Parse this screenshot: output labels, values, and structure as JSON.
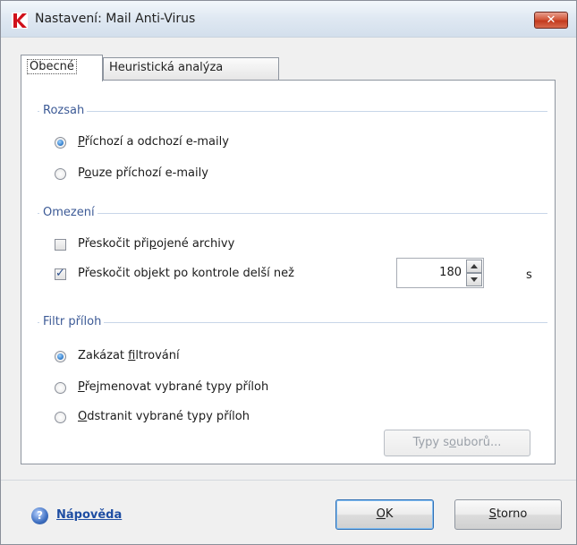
{
  "window": {
    "title": "Nastavení: Mail Anti-Virus",
    "close_glyph": "✕"
  },
  "tabs": [
    {
      "label": "Obecné",
      "active": true
    },
    {
      "label": "Heuristická analýza",
      "active": false
    }
  ],
  "rozsah": {
    "title": "Rozsah",
    "options": [
      {
        "label_pre": "",
        "label_u": "P",
        "label_post": "říchozí a odchozí e-maily",
        "selected": true
      },
      {
        "label_pre": "P",
        "label_u": "o",
        "label_post": "uze příchozí e-maily",
        "selected": false
      }
    ]
  },
  "omezeni": {
    "title": "Omezení",
    "items": [
      {
        "label_pre": "Přeskočit při",
        "label_u": "p",
        "label_post": "ojené archivy",
        "checked": false
      },
      {
        "label": "Přeskočit objekt po kontrole delší než",
        "checked": true
      }
    ],
    "timeout_value": "180",
    "unit": "s"
  },
  "filtr": {
    "title": "Filtr příloh",
    "options": [
      {
        "label_pre": "Zakázat ",
        "label_u": "f",
        "label_post": "iltrování",
        "selected": true
      },
      {
        "label_pre": "",
        "label_u": "P",
        "label_post": "řejmenovat vybrané typy příloh",
        "selected": false
      },
      {
        "label_pre": "",
        "label_u": "O",
        "label_post": "dstranit vybrané typy příloh",
        "selected": false
      }
    ],
    "file_types_pre": "Typy s",
    "file_types_u": "o",
    "file_types_post": "uborů..."
  },
  "footer": {
    "help_label": "Nápověda",
    "help_glyph": "?",
    "ok_u": "O",
    "ok_post": "K",
    "cancel_u": "S",
    "cancel_post": "torno"
  },
  "colors": {
    "group_title": "#3c5a96",
    "link": "#1f4ea3",
    "close_button": "#c33a1e"
  }
}
